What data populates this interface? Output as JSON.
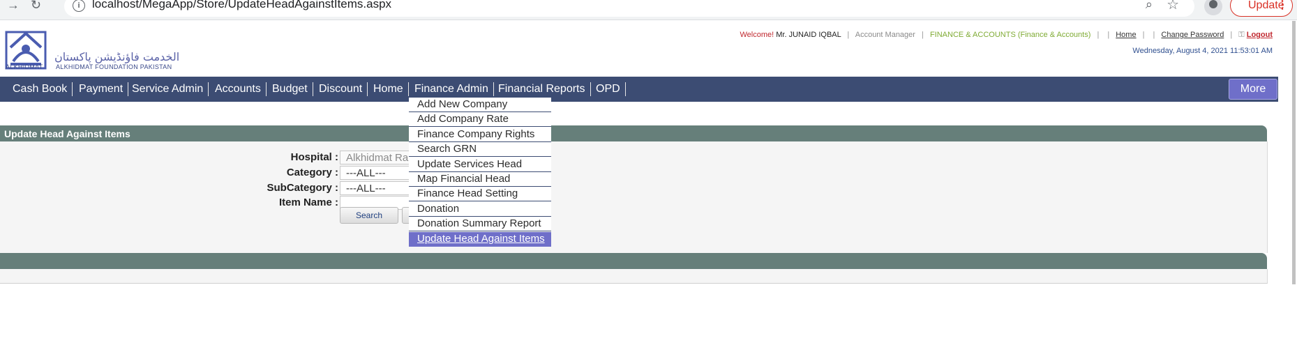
{
  "browser": {
    "url_prefix": "localhost",
    "url_path": "/MegaApp/Store/UpdateHeadAgainstItems.aspx",
    "update_label": "Update",
    "back_icon": "arrow-right-icon",
    "reload_icon": "reload-icon"
  },
  "header": {
    "logo_text_urdu": "الخدمت فاؤنڈیشن پاکستان",
    "logo_text_small": "ALKHIDMAT",
    "logo_text_eng": "ALKHIDMAT FOUNDATION PAKISTAN",
    "welcome": "Welcome!",
    "user_name": "Mr. JUNAID IQBAL",
    "role": "Account Manager",
    "department": "FINANCE & ACCOUNTS (Finance & Accounts)",
    "home_link": "Home",
    "change_password": "Change Password",
    "logout": "Logout",
    "datetime": "Wednesday, August 4, 2021 11:53:01 AM"
  },
  "nav": {
    "items": [
      "Cash Book",
      "Payment",
      "Service Admin",
      "Accounts",
      "Budget",
      "Discount",
      "Home",
      "Finance Admin",
      "Financial Reports",
      "OPD"
    ],
    "more": "More"
  },
  "dropdown": {
    "items": [
      "Add New Company",
      "Add Company Rate",
      "Finance Company Rights",
      "Search GRN",
      "Update Services Head",
      "Map Financial Head",
      "Finance Head Setting",
      "Donation",
      "Donation Summary Report",
      "Update Head Against Items"
    ],
    "active_index": 9
  },
  "panel": {
    "title": "Update Head Against Items"
  },
  "form": {
    "hospital_label": "Hospital :",
    "hospital_value": "Alkhidmat Ra",
    "category_label": "Category :",
    "category_value": "---ALL---",
    "subcategory_label": "SubCategory :",
    "subcategory_value": "---ALL---",
    "itemname_label": "Item Name :",
    "itemname_value": "",
    "search_label": "Search"
  },
  "colors": {
    "navbar": "#3c4c73",
    "panel_header": "#667f7a",
    "active_menu": "#6f6fc9"
  }
}
